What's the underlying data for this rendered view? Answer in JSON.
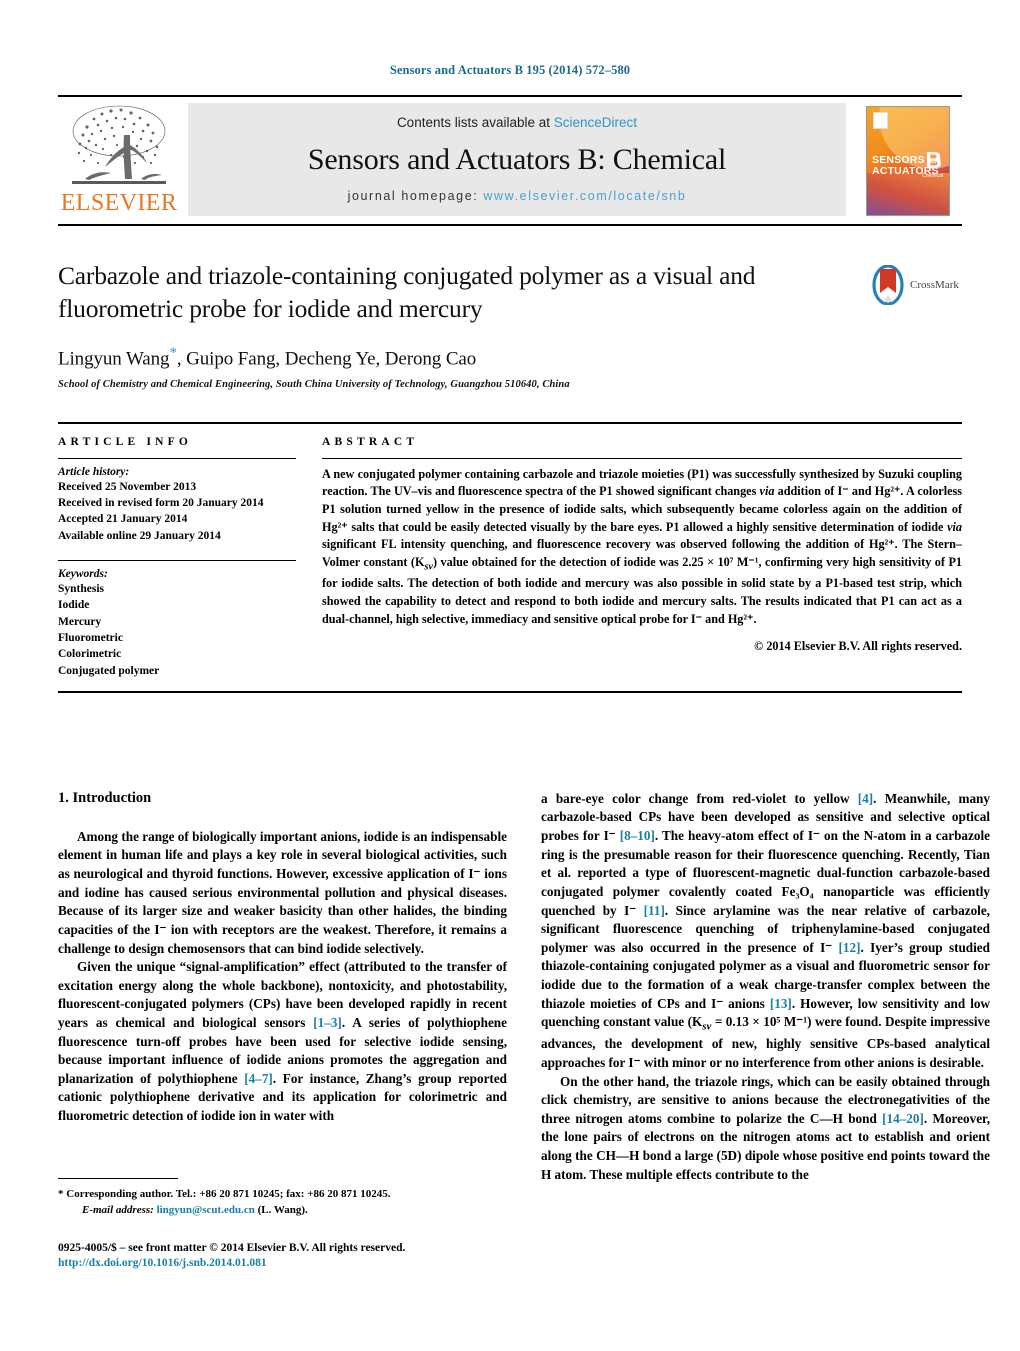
{
  "running_head": "Sensors and Actuators B 195 (2014) 572–580",
  "masthead": {
    "publisher_name": "ELSEVIER",
    "contents_prefix": "Contents lists available at ",
    "contents_link": "ScienceDirect",
    "journal_title": "Sensors and Actuators B: Chemical",
    "homepage_prefix": "journal homepage: ",
    "homepage_url": "www.elsevier.com/locate/snb",
    "cover": {
      "line1": "SENSORS",
      "line1_small": "and",
      "line2": "ACTUATORS",
      "letter": "B",
      "sub": "Chemical"
    }
  },
  "article": {
    "title": "Carbazole and triazole-containing conjugated polymer as a visual and fluorometric probe for iodide and mercury",
    "crossmark_label": "CrossMark",
    "authors": "Lingyun Wang",
    "authors_rest": ", Guipo Fang, Decheng Ye, Derong Cao",
    "affiliation": "School of Chemistry and Chemical Engineering, South China University of Technology, Guangzhou 510640, China"
  },
  "info": {
    "heading": "ARTICLE INFO",
    "history_label": "Article history:",
    "history": [
      "Received 25 November 2013",
      "Received in revised form 20 January 2014",
      "Accepted 21 January 2014",
      "Available online 29 January 2014"
    ],
    "keywords_label": "Keywords:",
    "keywords": [
      "Synthesis",
      "Iodide",
      "Mercury",
      "Fluorometric",
      "Colorimetric",
      "Conjugated polymer"
    ]
  },
  "abstract": {
    "heading": "ABSTRACT",
    "text_p1": "A new conjugated polymer containing carbazole and triazole moieties (",
    "p1_bold": "P1",
    "text_p2": ") was successfully synthesized by Suzuki coupling reaction. The UV–vis and fluorescence spectra of the ",
    "text_p3": " showed significant changes ",
    "via": "via",
    "text_p4": " addition of I⁻ and Hg²⁺. A colorless ",
    "text_p5": " solution turned yellow in the presence of iodide salts, which subsequently became colorless again on the addition of Hg²⁺ salts that could be easily detected visually by the bare eyes. ",
    "text_p6": " allowed a highly sensitive determination of iodide ",
    "text_p7": " significant FL intensity quenching, and fluorescence recovery was observed following the addition of Hg²⁺. The Stern–Volmer constant (K",
    "ksv_sub": "sv",
    "text_p8": ") value obtained for the detection of iodide was 2.25 × 10⁷ M⁻¹, confirming very high sensitivity of ",
    "text_p9": " for iodide salts. The detection of both iodide and mercury was also possible in solid state by a ",
    "text_p10": "-based test strip, which showed the capability to detect and respond to both iodide and mercury salts. The results indicated that ",
    "text_p11": " can act as a dual-channel, high selective, immediacy and sensitive optical probe for I⁻ and Hg²⁺.",
    "copyright": "© 2014 Elsevier B.V. All rights reserved."
  },
  "body": {
    "section_number_title": "1.  Introduction",
    "left_paragraphs": [
      "Among the range of biologically important anions, iodide is an indispensable element in human life and plays a key role in several biological activities, such as neurological and thyroid functions. However, excessive application of I⁻ ions and iodine has caused serious environmental pollution and physical diseases. Because of its larger size and weaker basicity than other halides, the binding capacities of the I⁻ ion with receptors are the weakest. Therefore, it remains a challenge to design chemosensors that can bind iodide selectively."
    ],
    "left_p2_a": "Given the unique “signal-amplification” effect (attributed to the transfer of excitation energy along the whole backbone), nontoxicity, and photostability, fluorescent-conjugated polymers (CPs) have been developed rapidly in recent years as chemical and biological sensors ",
    "left_p2_ref1": "[1–3]",
    "left_p2_b": ". A series of polythiophene fluorescence turn-off probes have been used for selective iodide sensing, because important influence of iodide anions promotes the aggregation and planarization of polythiophene ",
    "left_p2_ref2": "[4–7]",
    "left_p2_c": ". For instance, Zhang’s group reported cationic polythiophene derivative and its application for colorimetric and fluorometric detection of iodide ion in water with",
    "right_p1_a": "a bare-eye color change from red-violet to yellow ",
    "right_p1_ref1": "[4]",
    "right_p1_b": ". Meanwhile, many carbazole-based CPs have been developed as sensitive and selective optical probes for I⁻ ",
    "right_p1_ref2": "[8–10]",
    "right_p1_c": ". The heavy-atom effect of I⁻ on the N-atom in a carbazole ring is the presumable reason for their fluorescence quenching. Recently, Tian et al. reported a type of fluorescent-magnetic dual-function carbazole-based conjugated polymer covalently coated Fe₃O₄ nanoparticle was efficiently quenched by I⁻ ",
    "right_p1_ref3": "[11]",
    "right_p1_d": ". Since arylamine was the near relative of carbazole, significant fluorescence quenching of triphenylamine-based conjugated polymer was also occurred in the presence of I⁻ ",
    "right_p1_ref4": "[12]",
    "right_p1_e": ". Iyer’s group studied thiazole-containing conjugated polymer as a visual and fluorometric sensor for iodide due to the formation of a weak charge-transfer complex between the thiazole moieties of CPs and I⁻ anions ",
    "right_p1_ref5": "[13]",
    "right_p1_f": ". However, low sensitivity and low quenching constant value (K",
    "right_p1_ksv": "sv",
    "right_p1_g": " = 0.13 × 10⁵ M⁻¹) were found. Despite impressive advances, the development of new, highly sensitive CPs-based analytical approaches for I⁻ with minor or no interference from other anions is desirable.",
    "right_p2_a": "On the other hand, the triazole rings, which can be easily obtained through click chemistry, are sensitive to anions because the electronegativities of the three nitrogen atoms combine to polarize the C—H bond ",
    "right_p2_ref1": "[14–20]",
    "right_p2_b": ". Moreover, the lone pairs of electrons on the nitrogen atoms act to establish and orient along the CH—H bond a large (5D) dipole whose positive end points toward the H atom. These multiple effects contribute to the"
  },
  "footer": {
    "corresponding_marker": "*",
    "corresponding": "Corresponding author. Tel.: +86 20 871 10245; fax: +86 20 871 10245.",
    "email_label": "E-mail address:",
    "email": "lingyun@scut.edu.cn",
    "email_suffix": " (L. Wang).",
    "issn_line": "0925-4005/$ – see front matter © 2014 Elsevier B.V. All rights reserved.",
    "doi": "http://dx.doi.org/10.1016/j.snb.2014.01.081"
  },
  "colors": {
    "link": "#1a7fa8",
    "elsevier_orange": "#E87722",
    "masthead_gray": "#e8e8e8",
    "sciencedirect_blue": "#2f93c8"
  }
}
